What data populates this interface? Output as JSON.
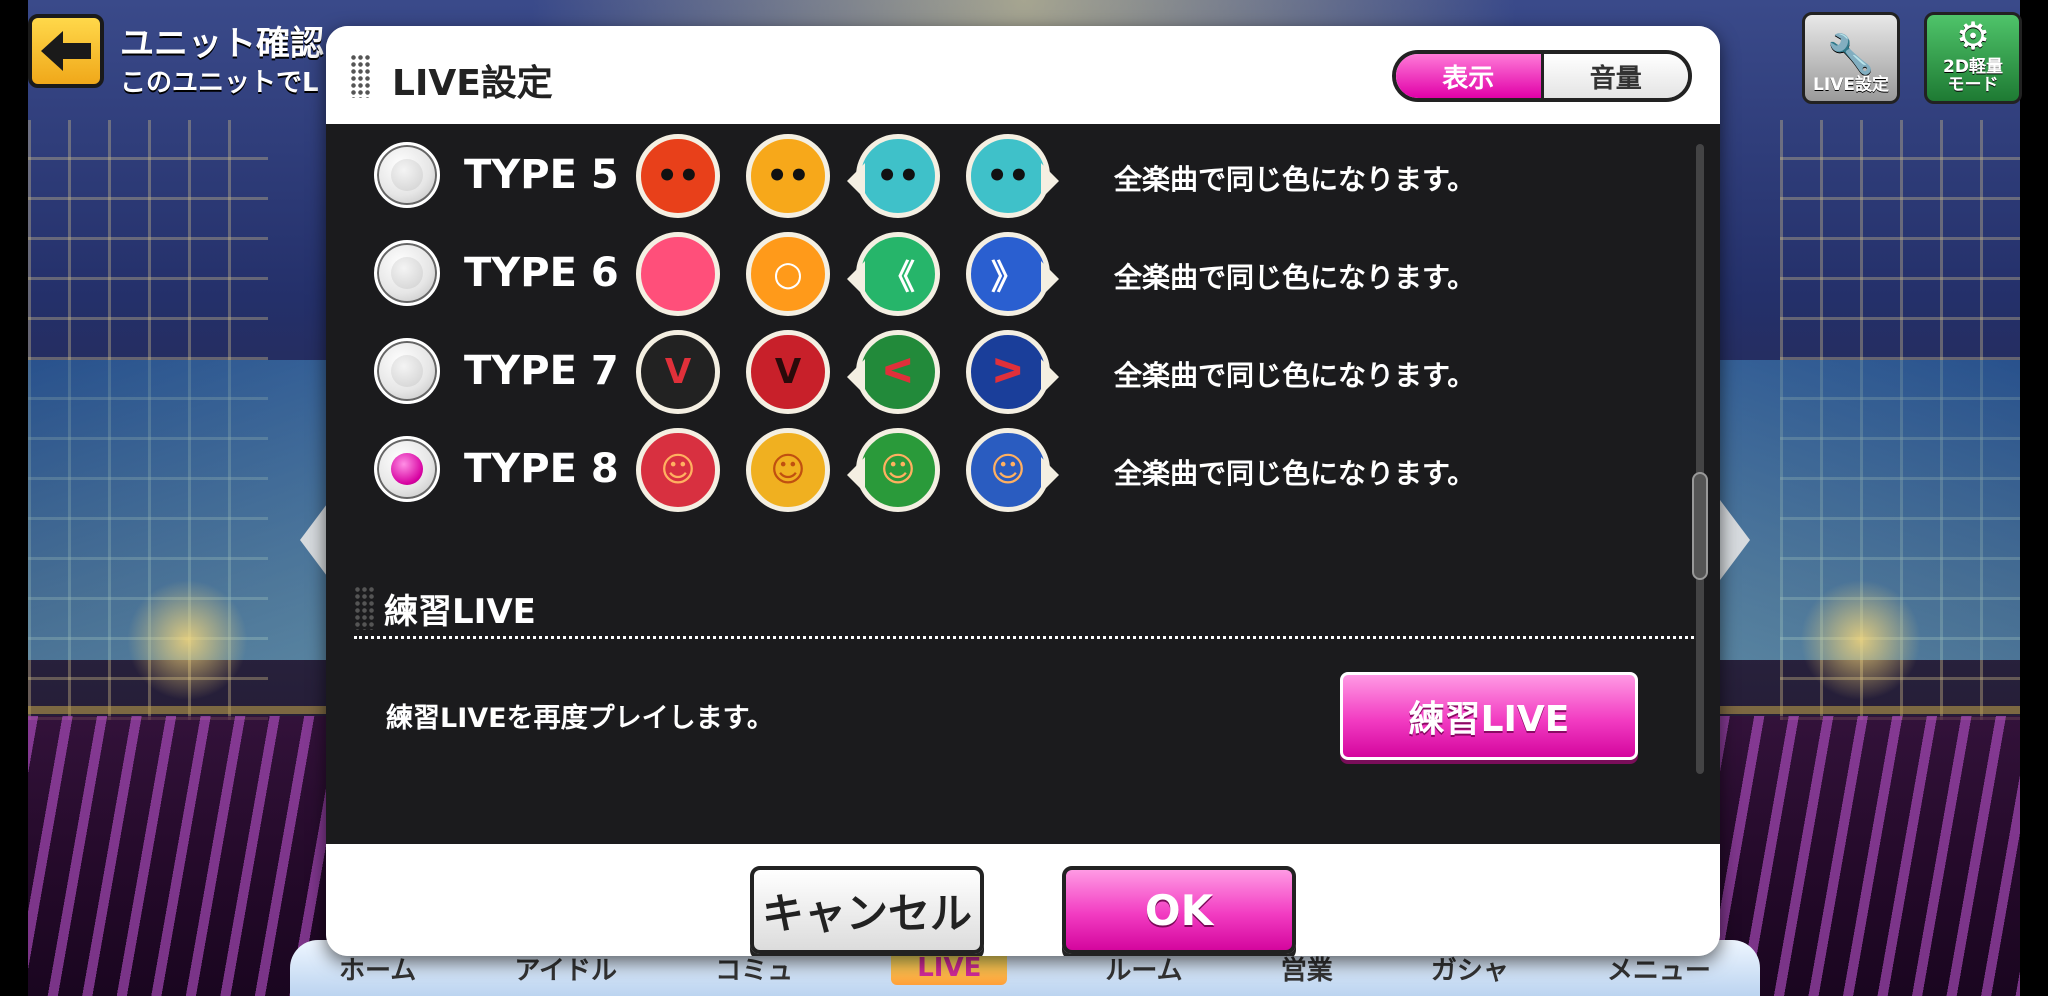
{
  "header": {
    "title": "ユニット確認",
    "subtitle": "このユニットでL"
  },
  "top_right": {
    "live_settings_label": "LIVE設定",
    "mode_label": "2D軽量\nモード"
  },
  "bottom_nav": [
    "ホーム",
    "アイドル",
    "コミュ",
    "LIVE",
    "ルーム",
    "営業",
    "ガシャ",
    "メニュー"
  ],
  "modal": {
    "title": "LIVE設定",
    "tabs": [
      {
        "label": "表示",
        "active": true
      },
      {
        "label": "音量",
        "active": false
      }
    ],
    "note_types": [
      {
        "label": "TYPE 5",
        "description": "全楽曲で同じ色になります。",
        "selected": false,
        "icons": [
          {
            "name": "red-face-note-icon",
            "color": "#e8401a",
            "glyph": "••"
          },
          {
            "name": "yellow-face-note-icon",
            "color": "#f7a81a",
            "glyph": "••"
          },
          {
            "name": "cyan-face-flick-left-icon",
            "color": "#3fc1c9",
            "glyph": "••"
          },
          {
            "name": "cyan-face-flick-right-icon",
            "color": "#3fc1c9",
            "glyph": "••"
          }
        ]
      },
      {
        "label": "TYPE 6",
        "description": "全楽曲で同じ色になります。",
        "selected": false,
        "icons": [
          {
            "name": "pink-circle-note-icon",
            "color": "#ff4f7a",
            "glyph": ""
          },
          {
            "name": "orange-ring-note-icon",
            "color": "#ff9a1a",
            "glyph": "○"
          },
          {
            "name": "green-chevron-left-icon",
            "color": "#26b56a",
            "glyph": "《"
          },
          {
            "name": "blue-chevron-right-icon",
            "color": "#2a5fd0",
            "glyph": "》"
          }
        ]
      },
      {
        "label": "TYPE 7",
        "description": "全楽曲で同じ色になります。",
        "selected": false,
        "icons": [
          {
            "name": "black-geass-note-icon",
            "color": "#222222",
            "glyph": "ᐯ"
          },
          {
            "name": "red-geass-note-icon",
            "color": "#c8202a",
            "glyph": "ᐯ"
          },
          {
            "name": "green-geass-flick-icon",
            "color": "#228a3a",
            "glyph": "ᐸ"
          },
          {
            "name": "blue-geass-flick-icon",
            "color": "#1a3e9a",
            "glyph": "ᐳ"
          }
        ]
      },
      {
        "label": "TYPE 8",
        "description": "全楽曲で同じ色になります。",
        "selected": true,
        "icons": [
          {
            "name": "red-agumon-note-icon",
            "color": "#d83040",
            "glyph": "☺"
          },
          {
            "name": "yellow-agumon-note-icon",
            "color": "#f0b020",
            "glyph": "☺"
          },
          {
            "name": "green-agumon-flick-icon",
            "color": "#2a9a3a",
            "glyph": "☺"
          },
          {
            "name": "blue-agumon-flick-icon",
            "color": "#2a5cc0",
            "glyph": "☺"
          }
        ]
      }
    ],
    "practice": {
      "title": "練習LIVE",
      "description": "練習LIVEを再度プレイします。",
      "button_label": "練習LIVE"
    },
    "footer": {
      "cancel_label": "キャンセル",
      "ok_label": "OK"
    }
  }
}
